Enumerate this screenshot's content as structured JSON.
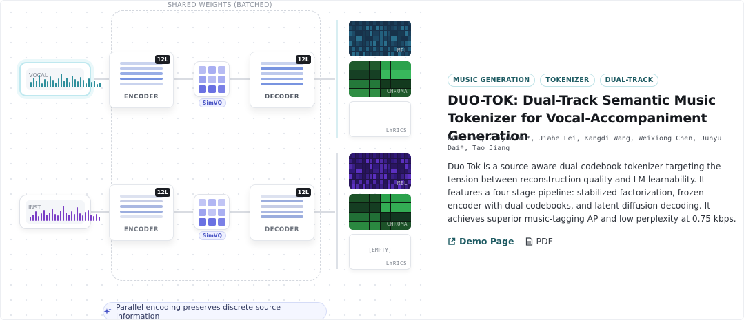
{
  "diagram": {
    "shared_label": "SHARED WEIGHTS (BATCHED)",
    "vocal_label": "VOCAL",
    "inst_label": "INST",
    "encoder_label": "ENCODER",
    "decoder_label": "DECODER",
    "layer_badge": "12L",
    "vq_label": "SimVQ",
    "mel_tag": "MEL",
    "chroma_tag": "CHROMA",
    "lyrics_tag": "LYRICS",
    "empty_text": "[EMPTY]",
    "caption": "Parallel encoding preserves discrete source information",
    "colors": {
      "vocal_accent": "#2e8f9c",
      "inst_accent": "#7a3ec6",
      "vq_accent": "#5b63e0",
      "chroma_green": "#2ba24c"
    }
  },
  "paper": {
    "tags": [
      "MUSIC GENERATION",
      "TOKENIZER",
      "DUAL-TRACK"
    ],
    "title": "DUO-TOK: Dual-Track Semantic Music Tokenizer for Vocal-Accompaniment Generation",
    "authors": "Rui Lin*, Zhiyue Wu*, Jiahe Lei, Kangdi Wang, Weixiong Chen, Junyu Dai*, Tao Jiang",
    "abstract": "Duo-Tok is a source-aware dual-codebook tokenizer targeting the tension between reconstruction quality and LM learnability. It features a four-stage pipeline: stabilized factorization, frozen encoder with dual codebooks, and latent diffusion decoding. It achieves superior music-tagging AP and low perplexity at 0.75 kbps.",
    "demo_link": "Demo Page",
    "pdf_link": "PDF",
    "demo_icon": "external-link-icon",
    "pdf_icon": "document-icon"
  }
}
